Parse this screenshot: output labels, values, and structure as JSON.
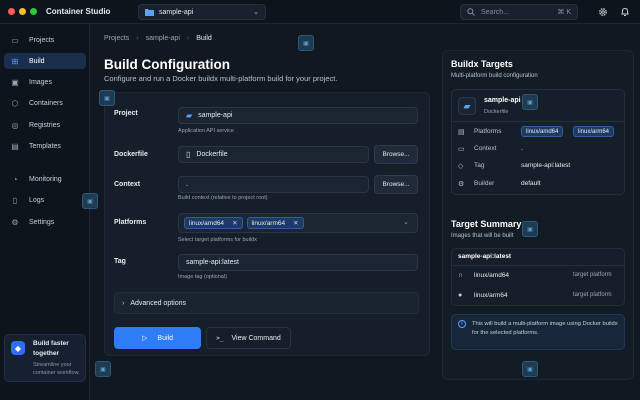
{
  "window": {
    "app_title": "Container Studio",
    "traffic_colors": [
      "#ff5f57",
      "#febc2e",
      "#28c840"
    ],
    "project_selector": {
      "value": "sample-api",
      "icon": "folder-icon"
    },
    "search": {
      "placeholder": "Search...",
      "shortcut": "⌘ K"
    },
    "icons": [
      "gear-icon",
      "bell-icon"
    ]
  },
  "sidebar": {
    "items": [
      {
        "label": "Projects",
        "icon": "projects-icon",
        "active": false
      },
      {
        "label": "Build",
        "icon": "build-icon",
        "active": true
      },
      {
        "label": "Images",
        "icon": "images-icon",
        "active": false
      },
      {
        "label": "Containers",
        "icon": "containers-icon",
        "active": false
      },
      {
        "label": "Registries",
        "icon": "registries-icon",
        "active": false
      },
      {
        "label": "Templates",
        "icon": "templates-icon",
        "active": false
      },
      {
        "label": "Monitoring",
        "icon": "monitoring-icon",
        "active": false
      },
      {
        "label": "Logs",
        "icon": "logs-icon",
        "active": false
      },
      {
        "label": "Settings",
        "icon": "settings-icon",
        "active": false
      }
    ],
    "promo": {
      "title": "Build faster together",
      "subtitle": "Streamline your container workflow."
    }
  },
  "breadcrumb": [
    "Projects",
    "sample-api",
    "Build"
  ],
  "page": {
    "title": "Build Configuration",
    "subtitle": "Configure and run a Docker buildx multi-platform build for your project."
  },
  "form": {
    "project": {
      "label": "Project",
      "value": "sample-api",
      "hint": "Application API service"
    },
    "dockerfile": {
      "label": "Dockerfile",
      "value": "Dockerfile",
      "browse": "Browse..."
    },
    "context": {
      "label": "Context",
      "value": ".",
      "hint": "Build context (relative to project root)",
      "browse": "Browse..."
    },
    "platforms": {
      "label": "Platforms",
      "chips": [
        "linux/amd64",
        "linux/arm64"
      ],
      "hint": "Select target platforms for buildx"
    },
    "tag": {
      "label": "Tag",
      "value": "sample-api:latest",
      "hint": "Image tag (optional)"
    },
    "advanced": "Advanced options",
    "build_button": "Build",
    "view_command_button": "View Command"
  },
  "targets": {
    "title": "Buildx Targets",
    "subtitle": "Multi-platform build configuration",
    "name": "sample-api",
    "kind": "Dockerfile",
    "rows": {
      "platforms_label": "Platforms",
      "platforms": [
        "linux/amd64",
        "linux/arm64"
      ],
      "context_label": "Context",
      "context": ".",
      "tag_label": "Tag",
      "tag": "sample-api:latest",
      "builder_label": "Builder",
      "builder": "default"
    }
  },
  "summary": {
    "title": "Target Summary",
    "subtitle": "Images that will be built",
    "image": "sample-api:latest",
    "platforms": [
      {
        "name": "linux/amd64",
        "type": "target platform",
        "icon": "linux-icon"
      },
      {
        "name": "linux/arm64",
        "type": "target platform",
        "icon": "apple-icon"
      }
    ],
    "info": "This will build a multi-platform image using Docker buildx for the selected platforms."
  },
  "accent_color": "#2e7cf6"
}
